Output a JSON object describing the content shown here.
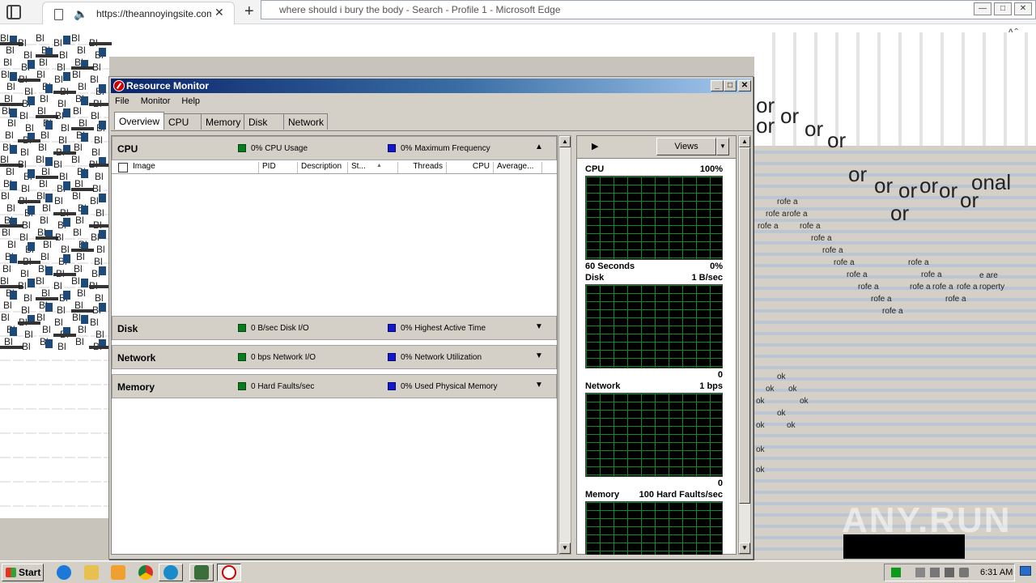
{
  "browser": {
    "tab_url": "https://theannoyingsite.com",
    "tab_close": "✕",
    "new_tab": "+",
    "window_title": "where should i bury the body - Search - Profile 1 - Microsoft Edge",
    "aa_label": "Aˆ",
    "back_glyph": "←"
  },
  "glitch": {
    "bl_text": "Bl",
    "or_text": "or",
    "onal_text": "onal",
    "rofe_text": "rofe a",
    "are_text": "e are",
    "property_text": "roperty",
    "ok_text": "ok",
    "watermark": "ANY.RUN"
  },
  "rm": {
    "title": "Resource Monitor",
    "window_controls": {
      "minimize": "_",
      "maximize": "□",
      "close": "✕"
    },
    "menu": [
      "File",
      "Monitor",
      "Help"
    ],
    "tabs": [
      "Overview",
      "CPU",
      "Memory",
      "Disk",
      "Network"
    ],
    "cpu": {
      "title": "CPU",
      "green_label": "0% CPU Usage",
      "blue_label": "0% Maximum Frequency",
      "columns": [
        "Image",
        "PID",
        "Description",
        "St...",
        "Threads",
        "CPU",
        "Average..."
      ]
    },
    "disk": {
      "title": "Disk",
      "green_label": "0 B/sec Disk I/O",
      "blue_label": "0% Highest Active Time"
    },
    "network": {
      "title": "Network",
      "green_label": "0 bps Network I/O",
      "blue_label": "0% Network Utilization"
    },
    "memory": {
      "title": "Memory",
      "green_label": "0 Hard Faults/sec",
      "blue_label": "0% Used Physical Memory"
    },
    "views_label": "Views",
    "graphs": {
      "cpu": {
        "title": "CPU",
        "value": "100%",
        "foot_left": "60 Seconds",
        "foot_right": "0%"
      },
      "disk": {
        "title": "Disk",
        "value": "1 B/sec",
        "foot_right": "0"
      },
      "network": {
        "title": "Network",
        "value": "1 bps",
        "foot_right": "0"
      },
      "memory": {
        "title": "Memory",
        "value": "100 Hard Faults/sec"
      }
    }
  },
  "taskbar": {
    "start_label": "Start",
    "clock": "6:31 AM"
  },
  "colors": {
    "graph_grid": "#0f8a26",
    "legend_green": "#0a7a1e",
    "legend_blue": "#1018c8",
    "titlebar_start": "#0a246a",
    "titlebar_end": "#a6caf0"
  }
}
